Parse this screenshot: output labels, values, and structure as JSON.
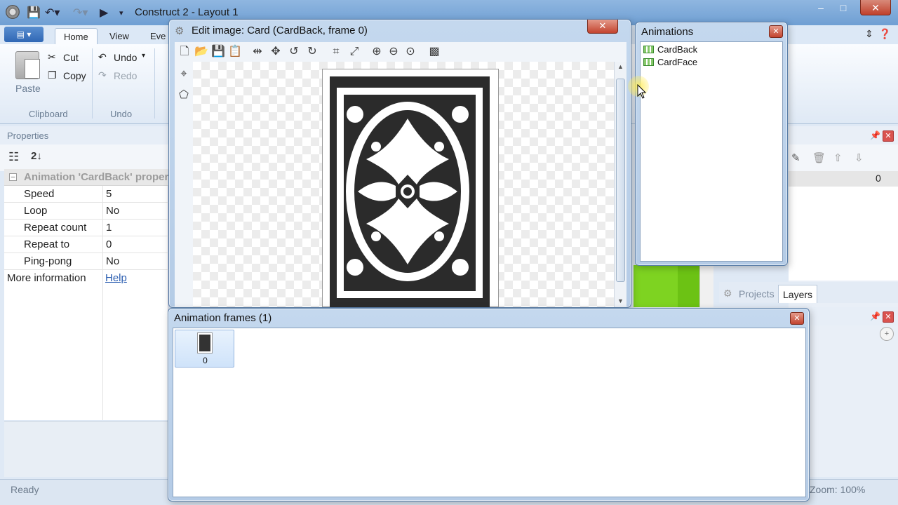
{
  "app": {
    "title": "Construct 2 - Layout 1",
    "window_controls": {
      "minimize": "–",
      "maximize": "□",
      "close": "✕"
    }
  },
  "ribbon": {
    "app_menu": "▤ ▾",
    "tabs": [
      "Home",
      "View",
      "Eve"
    ],
    "active_tab": "Home",
    "clipboard": {
      "paste": "Paste",
      "cut": "Cut",
      "copy": "Copy",
      "group_label": "Clipboard"
    },
    "undo": {
      "undo": "Undo",
      "redo": "Redo",
      "group_label": "Undo"
    }
  },
  "properties": {
    "header": "Properties",
    "group": "Animation 'CardBack' properties",
    "rows": [
      {
        "name": "Speed",
        "value": "5"
      },
      {
        "name": "Loop",
        "value": "No"
      },
      {
        "name": "Repeat count",
        "value": "1"
      },
      {
        "name": "Repeat to",
        "value": "0"
      },
      {
        "name": "Ping-pong",
        "value": "No"
      }
    ],
    "more_info_label": "More information",
    "help_link": "Help"
  },
  "edit_image": {
    "title": "Edit image: Card (CardBack, frame 0)",
    "close": "✕",
    "toolbar_icons": [
      "new-icon",
      "open-icon",
      "save-icon",
      "paste-icon",
      "flip-horizontal-icon",
      "flip-vertical-icon",
      "rotate-left-icon",
      "rotate-right-icon",
      "crop-icon",
      "resize-icon",
      "zoom-in-icon",
      "zoom-out-icon",
      "zoom-actual-icon",
      "alpha-icon"
    ]
  },
  "animations": {
    "title": "Animations",
    "close": "✕",
    "items": [
      "CardBack",
      "CardFace"
    ]
  },
  "animation_frames": {
    "title": "Animation frames (1)",
    "close": "✕",
    "frames": [
      {
        "index": "0"
      }
    ]
  },
  "layers": {
    "value": "0",
    "tabs": [
      "Projects",
      "Layers"
    ],
    "active_tab": "Layers"
  },
  "status": {
    "left": "Ready",
    "zoom": "Zoom: 100%"
  },
  "colors": {
    "accent_blue": "#6f9fd3",
    "close_red": "#c3442f",
    "link": "#2a5db0",
    "layer_green": "#7ed321"
  }
}
